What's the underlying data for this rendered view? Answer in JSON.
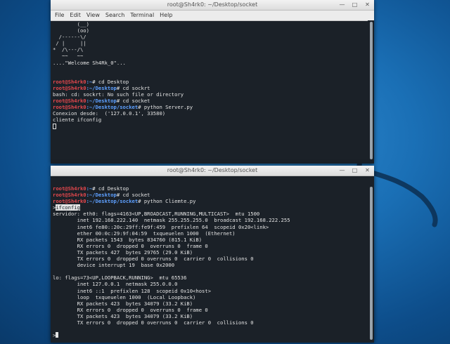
{
  "window1": {
    "title": "root@Sh4rk0: ~/Desktop/socket",
    "controls": [
      "—",
      "□",
      "✕"
    ],
    "menu": [
      "File",
      "Edit",
      "View",
      "Search",
      "Terminal",
      "Help"
    ],
    "lines": [
      {
        "text": "        (__)"
      },
      {
        "text": "        (oo)"
      },
      {
        "text": "  /------\\/"
      },
      {
        "text": " / |     ||"
      },
      {
        "text": "*  /\\---/\\"
      },
      {
        "text": "   ~~   ~~"
      },
      {
        "text": "....\"Welcome Sh4Rk_0\"..."
      },
      {
        "text": ""
      },
      {
        "text": ""
      },
      {
        "user": "root@Sh4rk0",
        "path": ":~",
        "cmd": "# cd Desktop"
      },
      {
        "user": "root@Sh4rk0",
        "path": ":~/Desktop",
        "cmd": "# cd sockrt"
      },
      {
        "text": "bash: cd: sockrt: No such file or directory"
      },
      {
        "user": "root@Sh4rk0",
        "path": ":~/Desktop",
        "cmd": "# cd socket"
      },
      {
        "user": "root@Sh4rk0",
        "path": ":~/Desktop/socket",
        "cmd": "# python Server.py"
      },
      {
        "text": "Conexion desde:  ('127.0.0.1', 33580)"
      },
      {
        "text": "cliente ifconfig"
      }
    ]
  },
  "window2": {
    "title": "root@Sh4rk0: ~/Desktop/socket",
    "controls": [
      "—",
      "□",
      "✕"
    ],
    "selected_input": "ifconfig",
    "lines": [
      {
        "user": "root@Sh4rk0",
        "path": ":~",
        "cmd": "# cd Desktop"
      },
      {
        "user": "root@Sh4rk0",
        "path": ":~/Desktop",
        "cmd": "# cd socket"
      },
      {
        "user": "root@Sh4rk0",
        "path": ":~/Desktop/socket",
        "cmd": "# python Cliemte.py"
      },
      {
        "text": "servidor: eth0: flags=4163<UP,BROADCAST,RUNNING,MULTICAST>  mtu 1500"
      },
      {
        "text": "        inet 192.168.222.140  netmask 255.255.255.0  broadcast 192.168.222.255"
      },
      {
        "text": "        inet6 fe80::20c:29ff:fe9f:459  prefixlen 64  scopeid 0x20<link>"
      },
      {
        "text": "        ether 00:0c:29:9f:04:59  txqueuelen 1000  (Ethernet)"
      },
      {
        "text": "        RX packets 1543  bytes 834760 (815.1 KiB)"
      },
      {
        "text": "        RX errors 0  dropped 0  overruns 0  frame 0"
      },
      {
        "text": "        TX packets 427  bytes 29765 (29.0 KiB)"
      },
      {
        "text": "        TX errors 0  dropped 0 overruns 0  carrier 0  collisions 0"
      },
      {
        "text": "        device interrupt 19  base 0x2000"
      },
      {
        "text": ""
      },
      {
        "text": "lo: flags=73<UP,LOOPBACK,RUNNING>  mtu 65536"
      },
      {
        "text": "        inet 127.0.0.1  netmask 255.0.0.0"
      },
      {
        "text": "        inet6 ::1  prefixlen 128  scopeid 0x10<host>"
      },
      {
        "text": "        loop  txqueuelen 1000  (Local Loopback)"
      },
      {
        "text": "        RX packets 423  bytes 34079 (33.2 KiB)"
      },
      {
        "text": "        RX errors 0  dropped 0  overruns 0  frame 0"
      },
      {
        "text": "        TX packets 423  bytes 34079 (33.2 KiB)"
      },
      {
        "text": "        TX errors 0  dropped 0 overruns 0  carrier 0  collisions 0"
      },
      {
        "text": ""
      }
    ],
    "final_prompt": ">"
  },
  "colors": {
    "terminal_bg": "#1b2128",
    "prompt_user": "#e5484d",
    "prompt_path": "#5ea0ff",
    "text": "#e3e3e3"
  }
}
